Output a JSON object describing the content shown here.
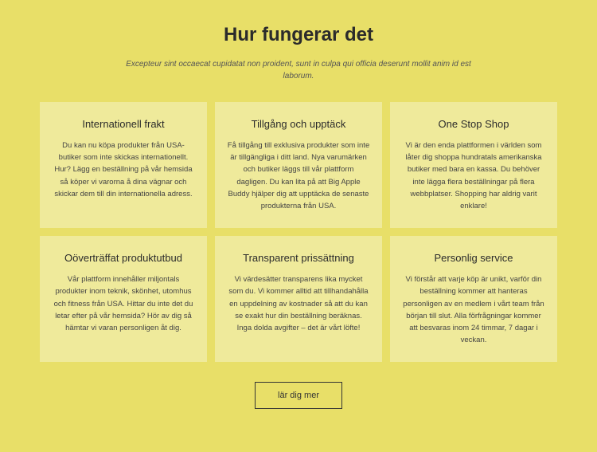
{
  "header": {
    "title": "Hur fungerar det",
    "subtitle": "Excepteur sint occaecat cupidatat non proident, sunt in culpa qui officia deserunt mollit anim id est laborum."
  },
  "cards": [
    {
      "title": "Internationell frakt",
      "body": "Du kan nu köpa produkter från USA-butiker som inte skickas internationellt. Hur? Lägg en beställning på vår hemsida så köper vi varorna å dina vägnar och skickar dem till din internationella adress."
    },
    {
      "title": "Tillgång och upptäck",
      "body": "Få tillgång till exklusiva produkter som inte är tillgängliga i ditt land. Nya varumärken och butiker läggs till vår plattform dagligen. Du kan lita på att Big Apple Buddy hjälper dig att upptäcka de senaste produkterna från USA."
    },
    {
      "title": "One Stop Shop",
      "body": "Vi är den enda plattformen i världen som låter dig shoppa hundratals amerikanska butiker med bara en kassa. Du behöver inte lägga flera beställningar på flera webbplatser. Shopping har aldrig varit enklare!"
    },
    {
      "title": "Oöverträffat produktutbud",
      "body": "Vår plattform innehåller miljontals produkter inom teknik, skönhet, utomhus och fitness från USA. Hittar du inte det du letar efter på vår hemsida? Hör av dig så hämtar vi varan personligen åt dig."
    },
    {
      "title": "Transparent prissättning",
      "body": "Vi värdesätter transparens lika mycket som du. Vi kommer alltid att tillhandahålla en uppdelning av kostnader så att du kan se exakt hur din beställning beräknas. Inga dolda avgifter – det är vårt löfte!"
    },
    {
      "title": "Personlig service",
      "body": "Vi förstår att varje köp är unikt, varför din beställning kommer att hanteras personligen av en medlem i vårt team från början till slut. Alla förfrågningar kommer att besvaras inom 24 timmar, 7 dagar i veckan."
    }
  ],
  "cta": {
    "label": "lär dig mer"
  }
}
